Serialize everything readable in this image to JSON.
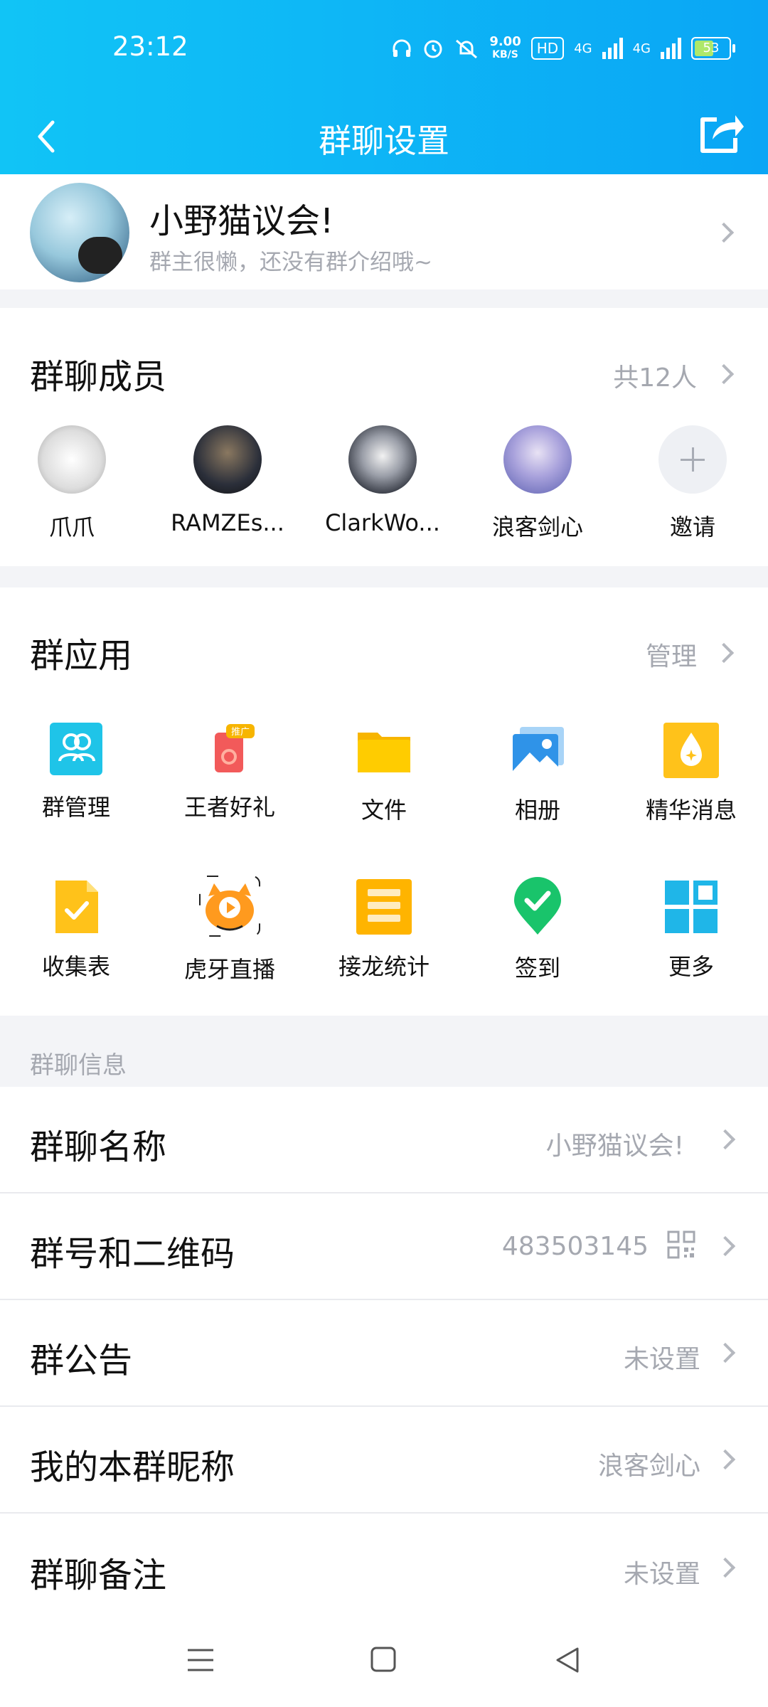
{
  "status_bar": {
    "time": "23:12",
    "speed_value": "9.00",
    "speed_unit": "KB/S",
    "hd_label": "HD",
    "net1": "4G",
    "net2": "4G",
    "battery": "53"
  },
  "nav": {
    "title": "群聊设置"
  },
  "group": {
    "name": "小野猫议会!",
    "description": "群主很懒，还没有群介绍哦~"
  },
  "members": {
    "title": "群聊成员",
    "count": "共12人",
    "items": [
      {
        "name": "爪爪",
        "color": "#e8e8e8"
      },
      {
        "name": "RAMZEs...",
        "color": "#2b2f3a"
      },
      {
        "name": "ClarkWo...",
        "color": "#3a3e48"
      },
      {
        "name": "浪客剑心",
        "color": "#7b86c7"
      }
    ],
    "invite": "邀请"
  },
  "apps": {
    "title": "群应用",
    "manage": "管理",
    "items": [
      {
        "label": "群管理",
        "icon": "group-manage-icon"
      },
      {
        "label": "王者好礼",
        "icon": "gift-icon",
        "badge": "推广"
      },
      {
        "label": "文件",
        "icon": "folder-icon"
      },
      {
        "label": "相册",
        "icon": "album-icon"
      },
      {
        "label": "精华消息",
        "icon": "essence-icon"
      },
      {
        "label": "收集表",
        "icon": "form-icon"
      },
      {
        "label": "虎牙直播",
        "icon": "huya-icon"
      },
      {
        "label": "接龙统计",
        "icon": "list-icon"
      },
      {
        "label": "签到",
        "icon": "checkin-icon"
      },
      {
        "label": "更多",
        "icon": "more-grid-icon"
      }
    ]
  },
  "info": {
    "section_label": "群聊信息",
    "rows": [
      {
        "label": "群聊名称",
        "value": "小野猫议会!"
      },
      {
        "label": "群号和二维码",
        "value": "483503145"
      },
      {
        "label": "群公告",
        "value": "未设置"
      },
      {
        "label": "我的本群昵称",
        "value": "浪客剑心"
      },
      {
        "label": "群聊备注",
        "value": "未设置"
      }
    ]
  },
  "colors": {
    "header_start": "#11c4f6",
    "header_end": "#0aa6f5",
    "secondary_text": "#a5a8b0"
  }
}
